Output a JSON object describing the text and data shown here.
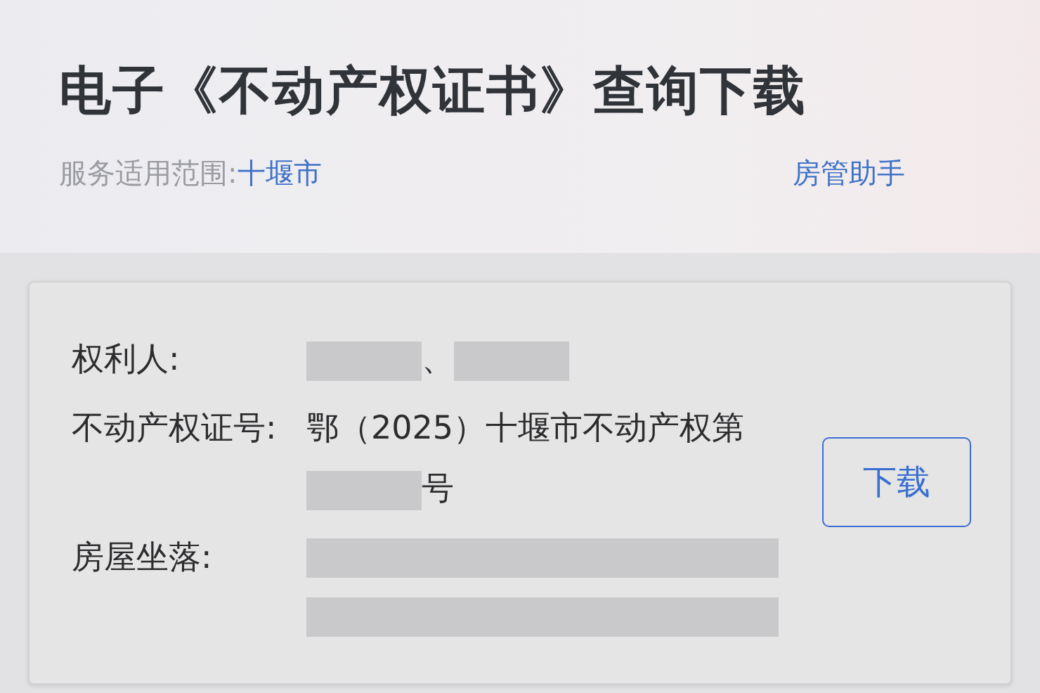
{
  "header": {
    "title": "电子《不动产权证书》查询下载",
    "scope_label": "服务适用范围:",
    "scope_value": "十堰市",
    "helper_link": "房管助手"
  },
  "record": {
    "fields": [
      {
        "label": "权利人:",
        "value": [
          {
            "kind": "redacted"
          },
          {
            "kind": "text",
            "text": "、"
          },
          {
            "kind": "redacted"
          }
        ]
      },
      {
        "label": "不动产权证号:",
        "value": [
          {
            "kind": "text",
            "text": "鄂（2025）十堰市不动产权第"
          },
          {
            "kind": "redacted"
          },
          {
            "kind": "text",
            "text": "号"
          }
        ]
      },
      {
        "label": "房屋坐落:",
        "value": [
          {
            "kind": "redacted_line"
          },
          {
            "kind": "redacted_line"
          }
        ]
      }
    ],
    "download_button": "下载"
  }
}
